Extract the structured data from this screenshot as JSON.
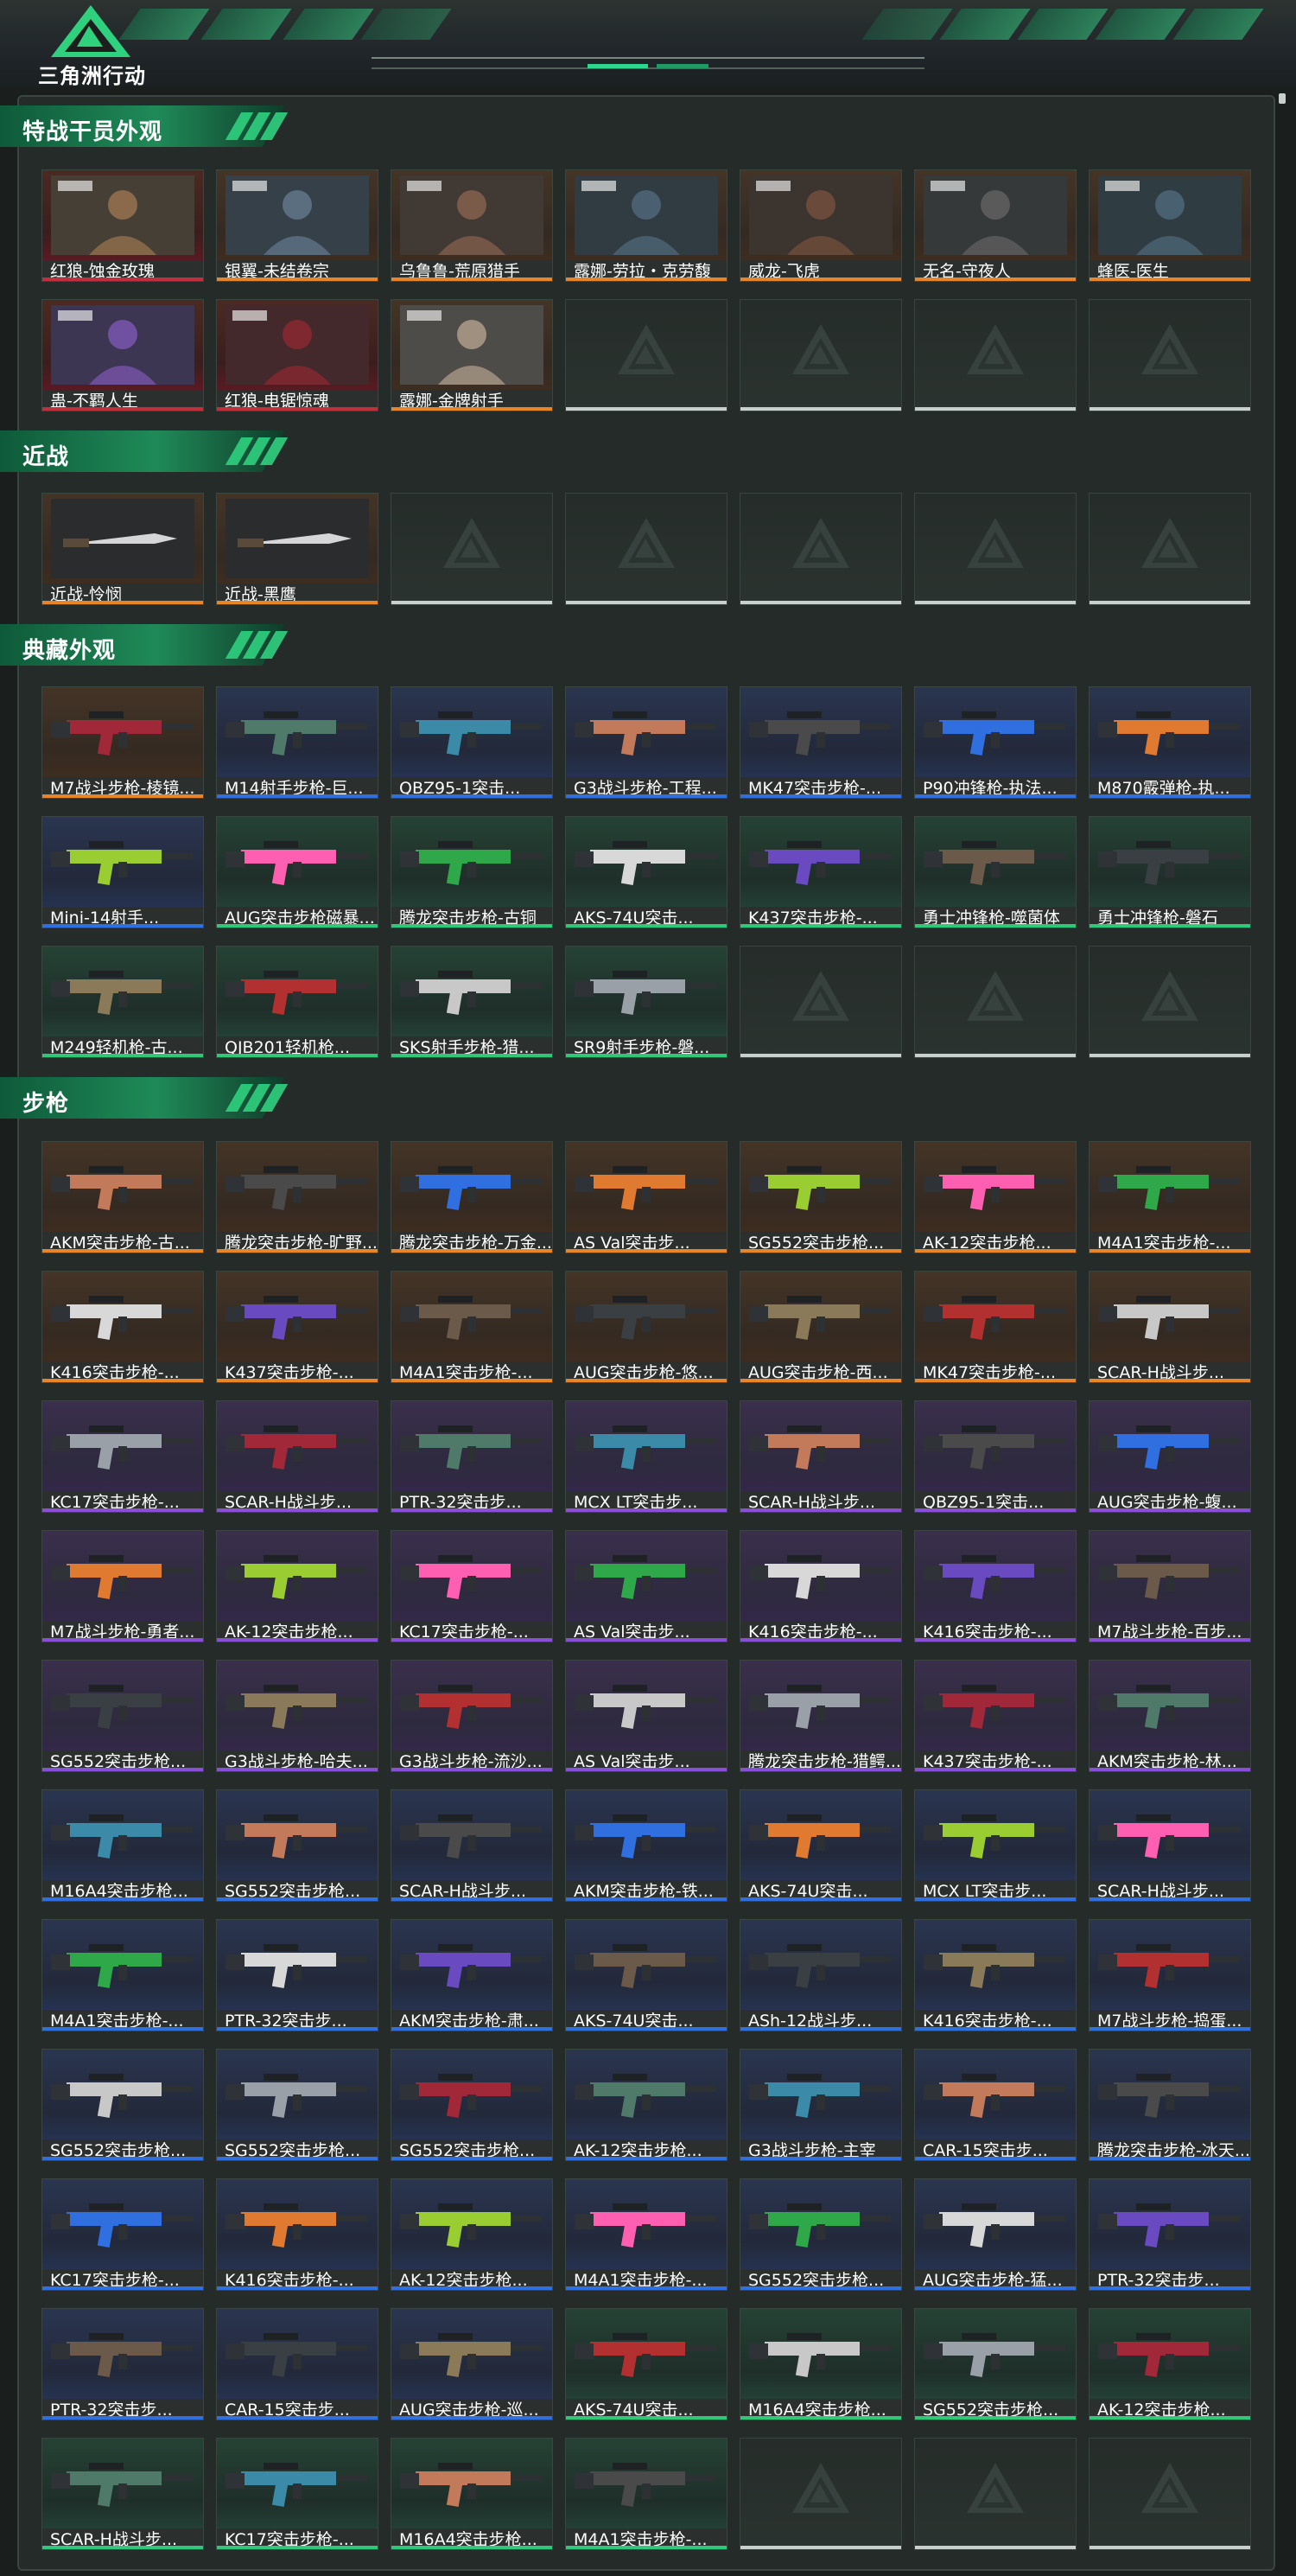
{
  "brand": {
    "name": "三角洲行动",
    "logo_icon": "delta-triangle-logo-icon"
  },
  "colors": {
    "accent": "#2fd07e",
    "gold": "#e8842a",
    "red": "#c0303c",
    "purple": "#8a4fd8",
    "blue": "#2f6fe0",
    "green": "#2fc77a",
    "gray": "#c9cfcc"
  },
  "sections": [
    {
      "id": "operators",
      "title": "特战干员外观",
      "cards": [
        {
          "label": "红狼-蚀金玫瑰",
          "rarity": "red"
        },
        {
          "label": "银翼-未结卷宗",
          "rarity": "gold"
        },
        {
          "label": "乌鲁鲁-荒原猎手",
          "rarity": "gold"
        },
        {
          "label": "露娜-劳拉・克劳馥",
          "rarity": "gold"
        },
        {
          "label": "威龙-飞虎",
          "rarity": "gold"
        },
        {
          "label": "无名-守夜人",
          "rarity": "gold"
        },
        {
          "label": "蜂医-医生",
          "rarity": "gold"
        },
        {
          "label": "蛊-不羁人生",
          "rarity": "red"
        },
        {
          "label": "红狼-电锯惊魂",
          "rarity": "red"
        },
        {
          "label": "露娜-金牌射手",
          "rarity": "gold"
        }
      ],
      "empty": 4
    },
    {
      "id": "melee",
      "title": "近战",
      "cards": [
        {
          "label": "近战-怜悯",
          "rarity": "gold"
        },
        {
          "label": "近战-黑鹰",
          "rarity": "gold"
        }
      ],
      "empty": 5
    },
    {
      "id": "collection",
      "title": "典藏外观",
      "cards": [
        {
          "label": "M7战斗步枪-棱镜...",
          "rarity": "gold"
        },
        {
          "label": "M14射手步枪-巨...",
          "rarity": "blue"
        },
        {
          "label": "QBZ95-1突击...",
          "rarity": "blue"
        },
        {
          "label": "G3战斗步枪-工程...",
          "rarity": "blue"
        },
        {
          "label": "MK47突击步枪-...",
          "rarity": "blue"
        },
        {
          "label": "P90冲锋枪-执法...",
          "rarity": "blue"
        },
        {
          "label": "M870霰弹枪-执...",
          "rarity": "blue"
        },
        {
          "label": "Mini-14射手...",
          "rarity": "blue"
        },
        {
          "label": "AUG突击步枪磁暴...",
          "rarity": "green"
        },
        {
          "label": "腾龙突击步枪-古铜",
          "rarity": "green"
        },
        {
          "label": "AKS-74U突击...",
          "rarity": "green"
        },
        {
          "label": "K437突击步枪-...",
          "rarity": "green"
        },
        {
          "label": "勇士冲锋枪-噬菌体",
          "rarity": "green"
        },
        {
          "label": "勇士冲锋枪-磐石",
          "rarity": "green"
        },
        {
          "label": "M249轻机枪-古...",
          "rarity": "green"
        },
        {
          "label": "QJB201轻机枪...",
          "rarity": "green"
        },
        {
          "label": "SKS射手步枪-猎...",
          "rarity": "green"
        },
        {
          "label": "SR9射手步枪-磐...",
          "rarity": "green"
        }
      ],
      "empty": 3
    },
    {
      "id": "rifles",
      "title": "步枪",
      "cards": [
        {
          "label": "AKM突击步枪-古...",
          "rarity": "gold"
        },
        {
          "label": "腾龙突击步枪-旷野...",
          "rarity": "gold"
        },
        {
          "label": "腾龙突击步枪-万金...",
          "rarity": "gold"
        },
        {
          "label": "AS Val突击步...",
          "rarity": "gold"
        },
        {
          "label": "SG552突击步枪...",
          "rarity": "gold"
        },
        {
          "label": "AK-12突击步枪...",
          "rarity": "gold"
        },
        {
          "label": "M4A1突击步枪-...",
          "rarity": "gold"
        },
        {
          "label": "K416突击步枪-...",
          "rarity": "gold"
        },
        {
          "label": "K437突击步枪-...",
          "rarity": "gold"
        },
        {
          "label": "M4A1突击步枪-...",
          "rarity": "gold"
        },
        {
          "label": "AUG突击步枪-悠...",
          "rarity": "gold"
        },
        {
          "label": "AUG突击步枪-西...",
          "rarity": "gold"
        },
        {
          "label": "MK47突击步枪-...",
          "rarity": "gold"
        },
        {
          "label": "SCAR-H战斗步...",
          "rarity": "gold"
        },
        {
          "label": "KC17突击步枪-...",
          "rarity": "purple"
        },
        {
          "label": "SCAR-H战斗步...",
          "rarity": "purple"
        },
        {
          "label": "PTR-32突击步...",
          "rarity": "purple"
        },
        {
          "label": "MCX LT突击步...",
          "rarity": "purple"
        },
        {
          "label": "SCAR-H战斗步...",
          "rarity": "purple"
        },
        {
          "label": "QBZ95-1突击...",
          "rarity": "purple"
        },
        {
          "label": "AUG突击步枪-蝮...",
          "rarity": "purple"
        },
        {
          "label": "M7战斗步枪-勇者...",
          "rarity": "purple"
        },
        {
          "label": "AK-12突击步枪...",
          "rarity": "purple"
        },
        {
          "label": "KC17突击步枪-...",
          "rarity": "purple"
        },
        {
          "label": "AS Val突击步...",
          "rarity": "purple"
        },
        {
          "label": "K416突击步枪-...",
          "rarity": "purple"
        },
        {
          "label": "K416突击步枪-...",
          "rarity": "purple"
        },
        {
          "label": "M7战斗步枪-百步...",
          "rarity": "purple"
        },
        {
          "label": "SG552突击步枪...",
          "rarity": "purple"
        },
        {
          "label": "G3战斗步枪-哈夫...",
          "rarity": "purple"
        },
        {
          "label": "G3战斗步枪-流沙...",
          "rarity": "purple"
        },
        {
          "label": "AS Val突击步...",
          "rarity": "purple"
        },
        {
          "label": "腾龙突击步枪-猎鳄...",
          "rarity": "purple"
        },
        {
          "label": "K437突击步枪-...",
          "rarity": "purple"
        },
        {
          "label": "AKM突击步枪-林...",
          "rarity": "purple"
        },
        {
          "label": "M16A4突击步枪...",
          "rarity": "blue"
        },
        {
          "label": "SG552突击步枪...",
          "rarity": "blue"
        },
        {
          "label": "SCAR-H战斗步...",
          "rarity": "blue"
        },
        {
          "label": "AKM突击步枪-铁...",
          "rarity": "blue"
        },
        {
          "label": "AKS-74U突击...",
          "rarity": "blue"
        },
        {
          "label": "MCX LT突击步...",
          "rarity": "blue"
        },
        {
          "label": "SCAR-H战斗步...",
          "rarity": "blue"
        },
        {
          "label": "M4A1突击步枪-...",
          "rarity": "blue"
        },
        {
          "label": "PTR-32突击步...",
          "rarity": "blue"
        },
        {
          "label": "AKM突击步枪-肃...",
          "rarity": "blue"
        },
        {
          "label": "AKS-74U突击...",
          "rarity": "blue"
        },
        {
          "label": "ASh-12战斗步...",
          "rarity": "blue"
        },
        {
          "label": "K416突击步枪-...",
          "rarity": "blue"
        },
        {
          "label": "M7战斗步枪-捣蛋...",
          "rarity": "blue"
        },
        {
          "label": "SG552突击步枪...",
          "rarity": "blue"
        },
        {
          "label": "SG552突击步枪...",
          "rarity": "blue"
        },
        {
          "label": "SG552突击步枪...",
          "rarity": "blue"
        },
        {
          "label": "AK-12突击步枪...",
          "rarity": "blue"
        },
        {
          "label": "G3战斗步枪-主宰",
          "rarity": "blue"
        },
        {
          "label": "CAR-15突击步...",
          "rarity": "blue"
        },
        {
          "label": "腾龙突击步枪-冰天...",
          "rarity": "blue"
        },
        {
          "label": "KC17突击步枪-...",
          "rarity": "blue"
        },
        {
          "label": "K416突击步枪-...",
          "rarity": "blue"
        },
        {
          "label": "AK-12突击步枪...",
          "rarity": "blue"
        },
        {
          "label": "M4A1突击步枪-...",
          "rarity": "blue"
        },
        {
          "label": "SG552突击步枪...",
          "rarity": "blue"
        },
        {
          "label": "AUG突击步枪-猛...",
          "rarity": "blue"
        },
        {
          "label": "PTR-32突击步...",
          "rarity": "blue"
        },
        {
          "label": "PTR-32突击步...",
          "rarity": "blue"
        },
        {
          "label": "CAR-15突击步...",
          "rarity": "blue"
        },
        {
          "label": "AUG突击步枪-巡...",
          "rarity": "blue"
        },
        {
          "label": "AKS-74U突击...",
          "rarity": "green"
        },
        {
          "label": "M16A4突击步枪...",
          "rarity": "green"
        },
        {
          "label": "SG552突击步枪...",
          "rarity": "green"
        },
        {
          "label": "AK-12突击步枪...",
          "rarity": "green"
        },
        {
          "label": "SCAR-H战斗步...",
          "rarity": "green"
        },
        {
          "label": "KC17突击步枪-...",
          "rarity": "green"
        },
        {
          "label": "M16A4突击步枪...",
          "rarity": "green"
        },
        {
          "label": "M4A1突击步枪-...",
          "rarity": "green"
        }
      ],
      "empty": 3
    }
  ]
}
